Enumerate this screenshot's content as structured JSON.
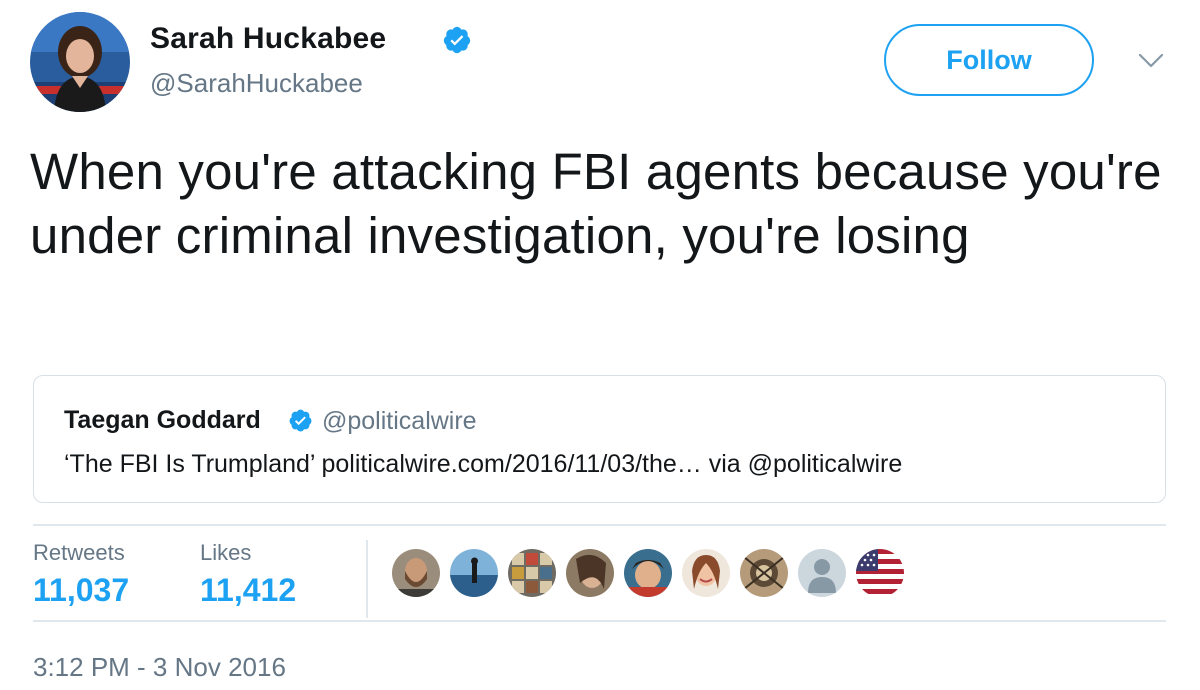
{
  "tweet": {
    "author_name": "Sarah Huckabee",
    "author_handle": "@SarahHuckabee",
    "follow_label": "Follow",
    "text": "When you're attacking FBI agents because you're under criminal investigation, you're losing",
    "timestamp": "3:12 PM - 3 Nov 2016"
  },
  "quote": {
    "author_name": "Taegan Goddard",
    "author_handle": "@politicalwire",
    "text": "‘The FBI Is Trumpland’ politicalwire.com/2016/11/03/the… via @politicalwire"
  },
  "stats": {
    "retweets_label": "Retweets",
    "retweets_count": "11,037",
    "likes_label": "Likes",
    "likes_count": "11,412"
  },
  "icons": {
    "verified": "verified-badge-icon",
    "menu": "chevron-down-icon",
    "default_avatar": "default-user-icon",
    "flag": "us-flag-icon"
  },
  "colors": {
    "accent": "#1da1f2",
    "text": "#14171a",
    "secondary_text": "#657786",
    "border": "#e1e8ed"
  }
}
